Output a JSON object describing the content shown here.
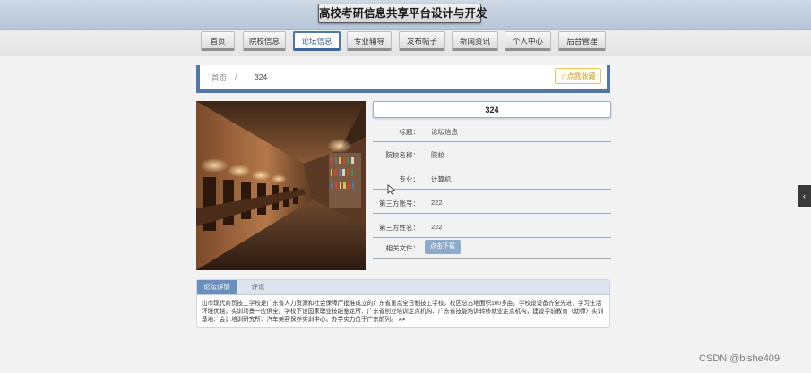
{
  "header": {
    "site_title": "高校考研信息共享平台设计与开发"
  },
  "nav": {
    "items": [
      {
        "label": "首页"
      },
      {
        "label": "院校信息"
      },
      {
        "label": "论坛信息"
      },
      {
        "label": "专业辅导"
      },
      {
        "label": "发布帖子"
      },
      {
        "label": "新闻资讯"
      },
      {
        "label": "个人中心"
      },
      {
        "label": "后台管理"
      }
    ],
    "active": "论坛信息"
  },
  "breadcrumb": {
    "home": "首页",
    "separator": "/",
    "current": "324"
  },
  "favorite": {
    "icon": "star-outline-icon",
    "label": "点我收藏"
  },
  "detail": {
    "title": "324",
    "fields": [
      {
        "label": "标题：",
        "value": "论坛信息"
      },
      {
        "label": "院校名称：",
        "value": "院校"
      },
      {
        "label": "专业：",
        "value": "计算机"
      },
      {
        "label": "第三方账号：",
        "value": "222"
      },
      {
        "label": "第三方姓名：",
        "value": "222"
      }
    ],
    "file": {
      "label": "相关文件：",
      "button": "点击下载"
    }
  },
  "tabs": [
    {
      "label": "论坛详情"
    },
    {
      "label": "评论"
    }
  ],
  "content": {
    "text": "山市现代商贸技工学校是广东省人力资源和社会保障厅批准成立的广东省重点全日制技工学校，校区总占地面积100多亩。学校设设备齐全先进，学习生活环境优越，实训场景一应俱全。学校下设国家职业技能鉴定所、广东省创业培训定点机构、广东省技能培训转移就业定点机构，建设学前教育（幼师）实训基地、会计培训研究所、汽车美容保养实训中心。办学实力位于广东前列。",
    "more": ">>"
  },
  "side_toggle": {
    "icon": "chevron-left-icon",
    "glyph": "‹"
  },
  "watermark": "CSDN @bishe409",
  "colors": {
    "accent": "#5177a9",
    "tab_active": "#6b8fba",
    "favorite": "#c9a12b",
    "download": "#8eaac9"
  }
}
